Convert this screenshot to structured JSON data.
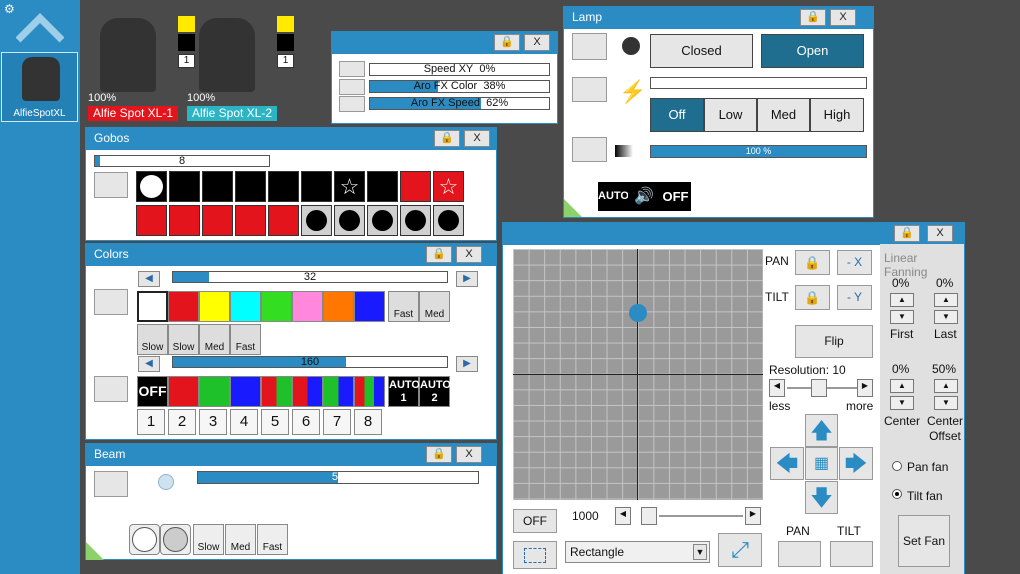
{
  "sidebar": {
    "fixture_label": "AlfieSpotXL"
  },
  "fixtures": [
    {
      "name": "Alfie Spot XL-1",
      "level": "100%",
      "channel": "1",
      "color": "#e3141b"
    },
    {
      "name": "Alfie Spot XL-2",
      "level": "100%",
      "channel": "1",
      "color": "#2bb5c4"
    }
  ],
  "fx": {
    "rows": [
      {
        "label": "Speed XY",
        "value": "0%",
        "fill": 0
      },
      {
        "label": "Aro FX Color",
        "value": "38%",
        "fill": 0.38
      },
      {
        "label": "Aro FX Speed",
        "value": "62%",
        "fill": 0.62
      }
    ]
  },
  "gobos": {
    "title": "Gobos",
    "bar_value": "8",
    "bar_fill": 0.03
  },
  "colors": {
    "title": "Colors",
    "bar1": "32",
    "bar1_fill": 0.13,
    "bar2": "160",
    "bar2_fill": 0.63,
    "swatches": [
      "#ffffff",
      "#e3141b",
      "#ffff00",
      "#00ffff",
      "#33dd22",
      "#ff88dd",
      "#ff7700",
      "#1a1aff"
    ],
    "rainbow_labels": [
      "Fast",
      "Med",
      "Slow",
      "Slow",
      "Med",
      "Fast"
    ],
    "row2": [
      "OFF",
      "",
      "",
      "",
      "",
      "",
      "AUTO 1",
      "AUTO 2"
    ],
    "numbers": [
      "1",
      "2",
      "3",
      "4",
      "5",
      "6",
      "7",
      "8"
    ]
  },
  "beam": {
    "title": "Beam",
    "value": "50",
    "fill": 0.5,
    "labels": [
      "Slow",
      "Med",
      "Fast"
    ]
  },
  "lamp": {
    "title": "Lamp",
    "closed": "Closed",
    "open": "Open",
    "off": "Off",
    "low": "Low",
    "med": "Med",
    "high": "High",
    "progress": "100 %",
    "auto": "AUTO",
    "off_badge": "OFF"
  },
  "pantilt": {
    "pan": "PAN",
    "tilt": "TILT",
    "neg_x": "- X",
    "neg_y": "- Y",
    "flip": "Flip",
    "resolution": "Resolution: 10",
    "less": "less",
    "more": "more",
    "off": "OFF",
    "speed": "1000",
    "shape": "Rectangle",
    "pan_btn": "PAN",
    "tilt_btn": "TILT",
    "linear_fanning": "Linear Fanning",
    "first_pct": "0%",
    "last_pct": "0%",
    "first": "First",
    "last": "Last",
    "center_pct": "0%",
    "offset_pct": "50%",
    "center": "Center",
    "center_offset": "Center Offset",
    "pan_fan": "Pan fan",
    "tilt_fan": "Tilt fan",
    "set_fan": "Set Fan"
  },
  "close": "X"
}
